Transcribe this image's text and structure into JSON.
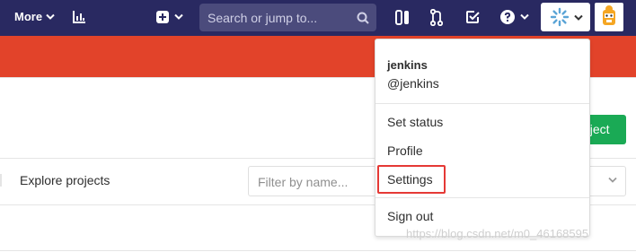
{
  "navbar": {
    "more_label": "More",
    "search_placeholder": "Search or jump to...",
    "icons": [
      "chevron-down-icon",
      "chart-icon",
      "plus-square-icon",
      "search-icon",
      "sidebar-panel-icon",
      "merge-request-icon",
      "todo-check-icon",
      "help-icon",
      "settings-wheel-icon",
      "avatar-icon"
    ]
  },
  "page": {
    "new_project_label": "oject",
    "explore_projects_label": "Explore projects",
    "filter_placeholder": "Filter by name..."
  },
  "user_menu": {
    "name": "jenkins",
    "handle": "@jenkins",
    "items": [
      "Set status",
      "Profile",
      "Settings",
      "Sign out"
    ]
  },
  "watermark": "https://blog.csdn.net/m0_46168595",
  "colors": {
    "navbar": "#292961",
    "banner": "#e2432a",
    "primary_button": "#1aaa55",
    "highlight_outline": "#e53935"
  }
}
